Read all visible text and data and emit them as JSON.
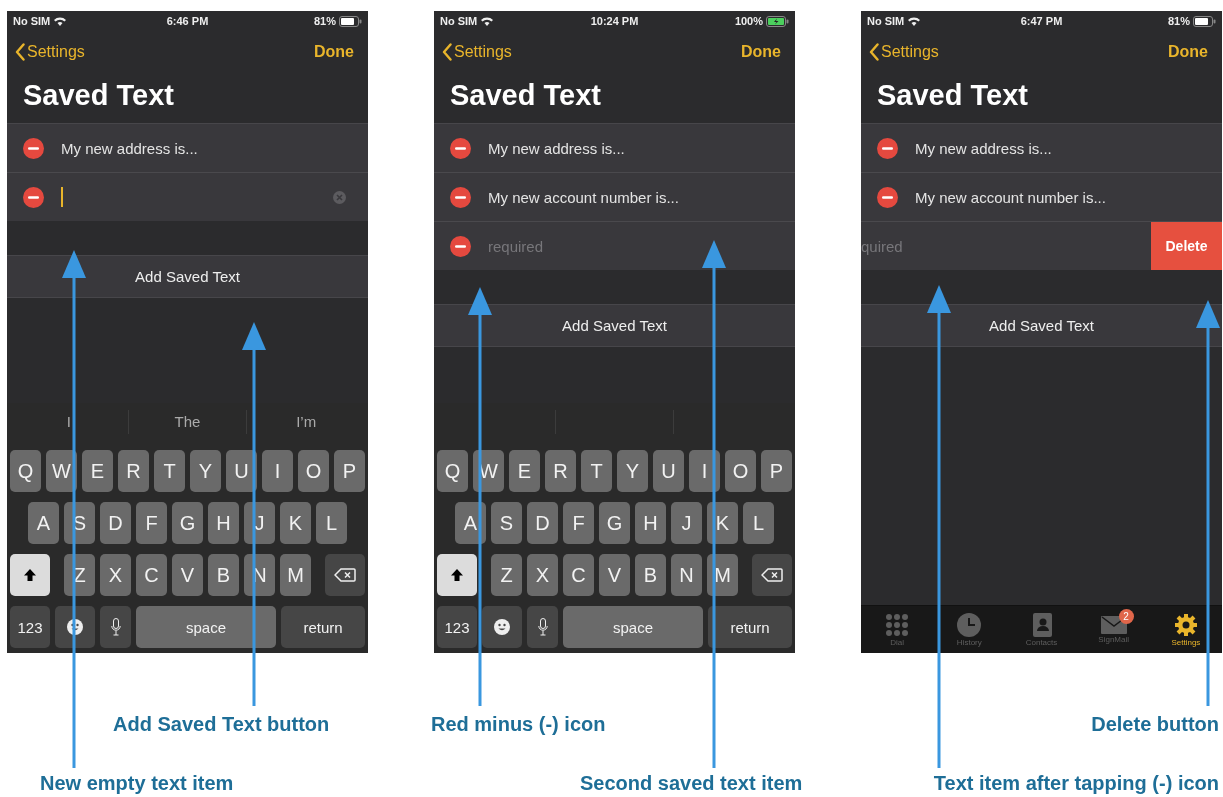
{
  "phones": [
    {
      "status": {
        "carrier": "No SIM",
        "time": "6:46 PM",
        "battery": "81%",
        "charging": false
      },
      "nav": {
        "back": "Settings",
        "done": "Done"
      },
      "title": "Saved Text",
      "items": [
        {
          "kind": "text",
          "text": "My new address is..."
        },
        {
          "kind": "editing"
        }
      ],
      "add_button": "Add Saved Text",
      "keyboard": {
        "suggestions": [
          "I",
          "The",
          "I’m"
        ],
        "letter_rows": [
          [
            "Q",
            "W",
            "E",
            "R",
            "T",
            "Y",
            "U",
            "I",
            "O",
            "P"
          ],
          [
            "A",
            "S",
            "D",
            "F",
            "G",
            "H",
            "J",
            "K",
            "L"
          ],
          [
            "Z",
            "X",
            "C",
            "V",
            "B",
            "N",
            "M"
          ]
        ],
        "shift_on": true,
        "numbers_key": "123",
        "space_key": "space",
        "return_key": "return"
      }
    },
    {
      "status": {
        "carrier": "No SIM",
        "time": "10:24 PM",
        "battery": "100%",
        "charging": true
      },
      "nav": {
        "back": "Settings",
        "done": "Done"
      },
      "title": "Saved Text",
      "items": [
        {
          "kind": "text",
          "text": "My new address is..."
        },
        {
          "kind": "text",
          "text": "My new account number is..."
        },
        {
          "kind": "placeholder",
          "placeholder": "required"
        }
      ],
      "add_button": "Add Saved Text",
      "keyboard": {
        "letter_rows": [
          [
            "Q",
            "W",
            "E",
            "R",
            "T",
            "Y",
            "U",
            "I",
            "O",
            "P"
          ],
          [
            "A",
            "S",
            "D",
            "F",
            "G",
            "H",
            "J",
            "K",
            "L"
          ],
          [
            "Z",
            "X",
            "C",
            "V",
            "B",
            "N",
            "M"
          ]
        ],
        "shift_on": true,
        "numbers_key": "123",
        "space_key": "space",
        "return_key": "return"
      }
    },
    {
      "status": {
        "carrier": "No SIM",
        "time": "6:47 PM",
        "battery": "81%",
        "charging": false
      },
      "nav": {
        "back": "Settings",
        "done": "Done"
      },
      "title": "Saved Text",
      "items": [
        {
          "kind": "text",
          "text": "My new address is..."
        },
        {
          "kind": "text",
          "text": "My new account number is..."
        },
        {
          "kind": "swiped",
          "placeholder": "quired",
          "action": "Delete"
        }
      ],
      "add_button": "Add Saved Text",
      "tab_bar": [
        {
          "kind": "dial",
          "label": "Dial",
          "selected": false
        },
        {
          "kind": "history",
          "label": "History",
          "selected": false
        },
        {
          "kind": "contacts",
          "label": "Contacts",
          "selected": false
        },
        {
          "kind": "mail",
          "label": "SignMail",
          "selected": false,
          "badge": "2"
        },
        {
          "kind": "settings",
          "label": "Settings",
          "selected": true
        }
      ]
    }
  ],
  "callouts": [
    "Add Saved Text button",
    "Red minus (-) icon",
    "Delete button",
    "New empty text item",
    "Second saved text item",
    "Text item after tapping (-) icon"
  ]
}
